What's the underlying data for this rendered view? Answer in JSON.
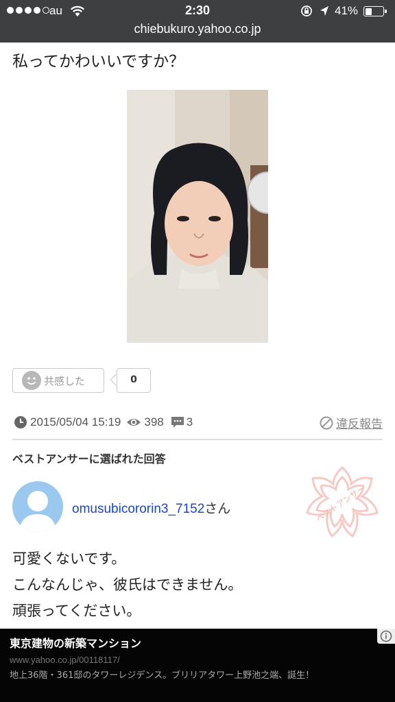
{
  "status_bar": {
    "carrier": "au",
    "time": "2:30",
    "battery_percent": "41%",
    "battery_level": 0.41
  },
  "url_bar": {
    "url": "chiebukuro.yahoo.co.jp"
  },
  "question": {
    "title": "私ってかわいいですか？",
    "sympathy_label": "共感した",
    "sympathy_count": "0",
    "date": "2015/05/04 15:19",
    "views": "398",
    "comments": "3",
    "report_label": "違反報告"
  },
  "best_answer": {
    "heading": "ベストアンサーに選ばれた回答",
    "username": "omusubicororin3_7152",
    "honorific": "さん",
    "lines": [
      "可愛くないです。",
      "こんなんじゃ、彼氏はできません。",
      "頑張ってください。"
    ],
    "stamp_text": "ベストアンサー"
  },
  "ad": {
    "title": "東京建物の新築マンション",
    "url": "www.yahoo.co.jp/00118117/",
    "description": "地上36階・361邸のタワーレジデンス。ブリリアタワー上野池之端、誕生！"
  },
  "colors": {
    "topbar": "#3d3f41",
    "link": "#1a46c8",
    "avatar": "#9bc8ef",
    "stamp": "#f7c9c4"
  }
}
